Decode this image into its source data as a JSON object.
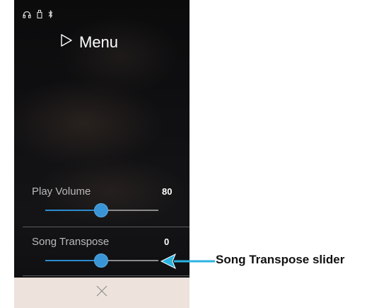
{
  "menu": {
    "title": "Menu"
  },
  "status_bar": {
    "icons": [
      "headphones-icon",
      "usb-icon",
      "bluetooth-icon"
    ]
  },
  "settings": [
    {
      "label": "Play Volume",
      "value": "80",
      "level": 0.5
    },
    {
      "label": "Song Transpose",
      "value": "0",
      "level": 0.5
    }
  ],
  "callout": {
    "label": "Song Transpose slider"
  },
  "colors": {
    "accent": "#2b8bd0",
    "bottom_bar": "#ede2dc",
    "callout_arrow": "#2bb3e0"
  }
}
